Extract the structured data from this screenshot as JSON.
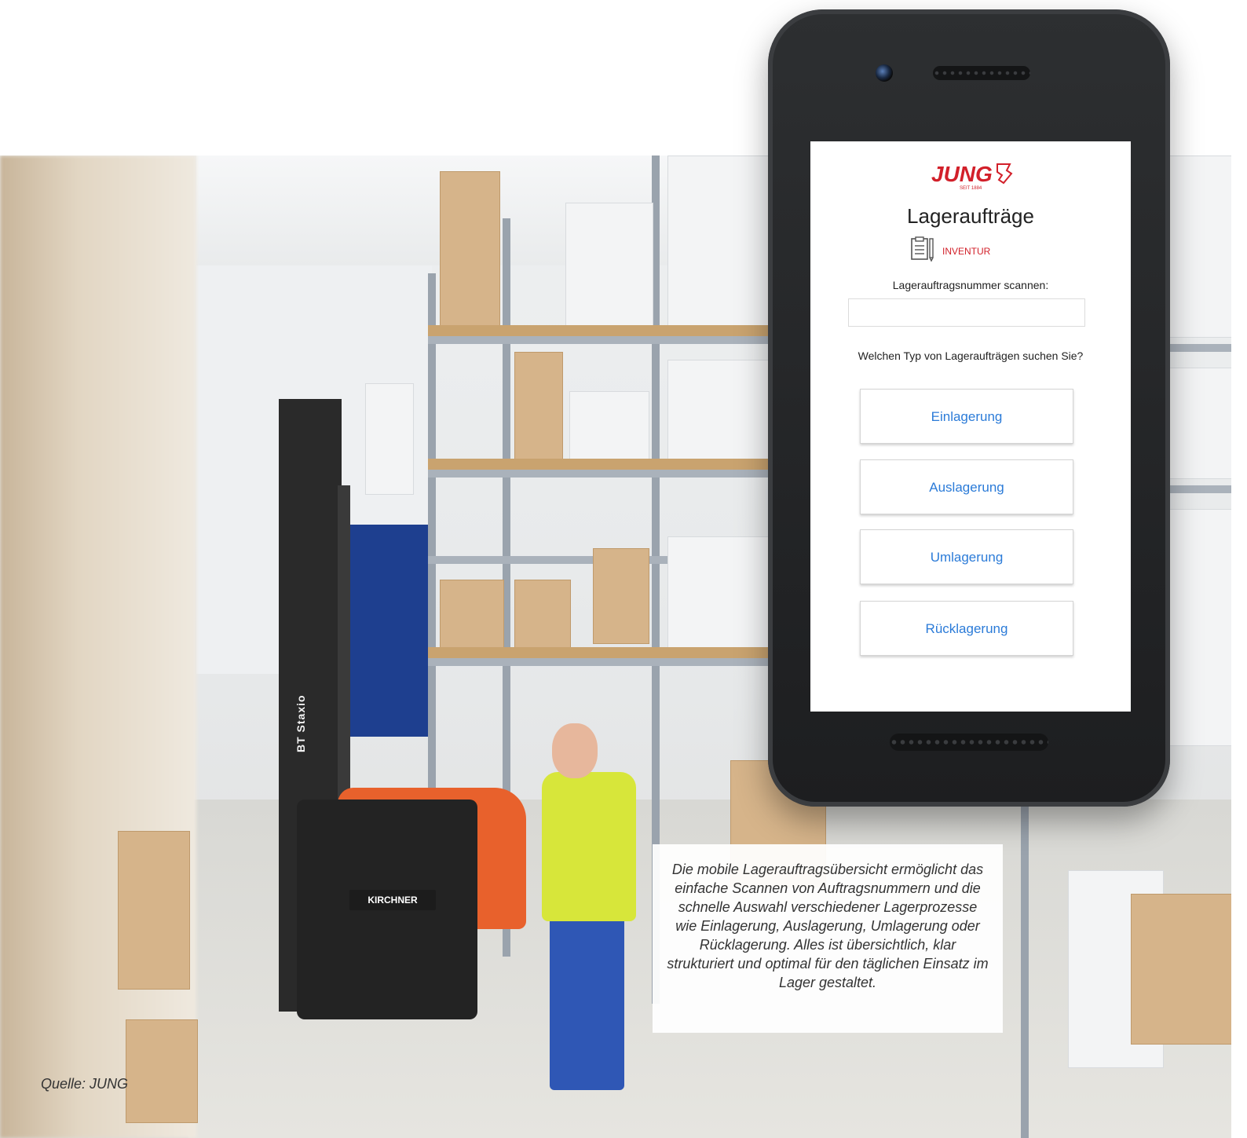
{
  "phone_app": {
    "brand": "JUNG",
    "brand_sub": "SEIT 1884",
    "title": "Lageraufträge",
    "mode_label": "INVENTUR",
    "scan_label": "Lagerauftragsnummer scannen:",
    "scan_value": "",
    "type_question": "Welchen Typ von Lageraufträgen suchen Sie?",
    "options": [
      {
        "label": "Einlagerung"
      },
      {
        "label": "Auslagerung"
      },
      {
        "label": "Umlagerung"
      },
      {
        "label": "Rücklagerung"
      }
    ],
    "colors": {
      "accent": "#2b7bd8",
      "brand": "#d2202a"
    }
  },
  "photo": {
    "truck_brand": "KIRCHNER",
    "mast_label": "BT Staxio"
  },
  "caption": "Die mobile Lagerauftragsübersicht ermöglicht das einfache Scannen von Auftragsnummern und die schnelle Auswahl verschiedener Lagerprozesse wie Einlagerung, Auslagerung, Umlagerung oder Rücklagerung. Alles ist übersichtlich, klar strukturiert und optimal für den täglichen Einsatz im Lager gestaltet.",
  "source": "Quelle:  JUNG"
}
